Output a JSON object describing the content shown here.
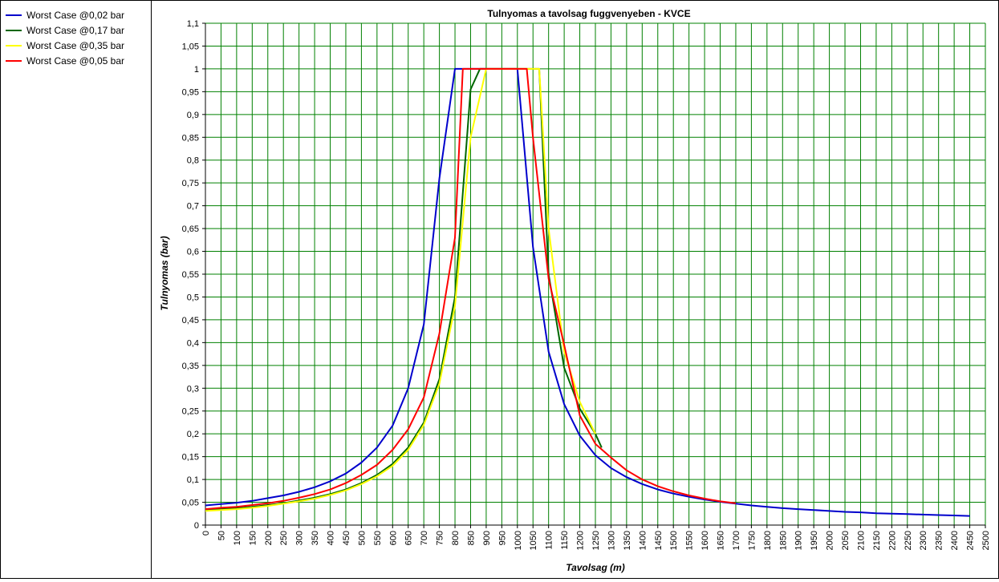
{
  "chart_data": {
    "type": "line",
    "title": "Tulnyomas a tavolsag fuggvenyeben - KVCE",
    "xlabel": "Tavolsag (m)",
    "ylabel": "Tulnyomas (bar)",
    "xlim": [
      0,
      2500
    ],
    "ylim": [
      0,
      1.1
    ],
    "x_ticks": [
      0,
      50,
      100,
      150,
      200,
      250,
      300,
      350,
      400,
      450,
      500,
      550,
      600,
      650,
      700,
      750,
      800,
      850,
      900,
      950,
      1000,
      1050,
      1100,
      1150,
      1200,
      1250,
      1300,
      1350,
      1400,
      1450,
      1500,
      1550,
      1600,
      1650,
      1700,
      1750,
      1800,
      1850,
      1900,
      1950,
      2000,
      2050,
      2100,
      2150,
      2200,
      2250,
      2300,
      2350,
      2400,
      2450,
      2500
    ],
    "x_tick_labels": [
      "0",
      "50",
      "100",
      "150",
      "200",
      "250",
      "300",
      "350",
      "400",
      "450",
      "500",
      "550",
      "600",
      "650",
      "700",
      "750",
      "800",
      "850",
      "900",
      "950",
      "1000",
      "1050",
      "1100",
      "1150",
      "1200",
      "1250",
      "1300",
      "1350",
      "1400",
      "1450",
      "1500",
      "1550",
      "1600",
      "1650",
      "1700",
      "1750",
      "1800",
      "1850",
      "1900",
      "1950",
      "2000",
      "2050",
      "2100",
      "2150",
      "2200",
      "2250",
      "2300",
      "2350",
      "2400",
      "2450",
      "2500"
    ],
    "y_ticks": [
      0,
      0.05,
      0.1,
      0.15,
      0.2,
      0.25,
      0.3,
      0.35,
      0.4,
      0.45,
      0.5,
      0.55,
      0.6,
      0.65,
      0.7,
      0.75,
      0.8,
      0.85,
      0.9,
      0.95,
      1,
      1.05,
      1.1
    ],
    "y_tick_labels": [
      "0",
      "0,05",
      "0,1",
      "0,15",
      "0,2",
      "0,25",
      "0,3",
      "0,35",
      "0,4",
      "0,45",
      "0,5",
      "0,55",
      "0,6",
      "0,65",
      "0,7",
      "0,75",
      "0,8",
      "0,85",
      "0,9",
      "0,95",
      "1",
      "1,05",
      "1,1"
    ],
    "grid": true,
    "grid_color": "#008000",
    "legend_position": "left panel",
    "series": [
      {
        "name": "Worst Case @0,02 bar",
        "color": "#0000cc",
        "points": [
          [
            0,
            0.043
          ],
          [
            50,
            0.046
          ],
          [
            100,
            0.049
          ],
          [
            150,
            0.053
          ],
          [
            200,
            0.059
          ],
          [
            250,
            0.065
          ],
          [
            300,
            0.073
          ],
          [
            350,
            0.083
          ],
          [
            400,
            0.096
          ],
          [
            450,
            0.113
          ],
          [
            500,
            0.137
          ],
          [
            550,
            0.17
          ],
          [
            600,
            0.218
          ],
          [
            650,
            0.3
          ],
          [
            700,
            0.44
          ],
          [
            750,
            0.76
          ],
          [
            800,
            1.0
          ],
          [
            1000,
            1.0
          ],
          [
            1050,
            0.61
          ],
          [
            1100,
            0.38
          ],
          [
            1150,
            0.265
          ],
          [
            1200,
            0.196
          ],
          [
            1250,
            0.153
          ],
          [
            1300,
            0.125
          ],
          [
            1350,
            0.105
          ],
          [
            1400,
            0.09
          ],
          [
            1450,
            0.078
          ],
          [
            1500,
            0.069
          ],
          [
            1550,
            0.062
          ],
          [
            1600,
            0.056
          ],
          [
            1650,
            0.051
          ],
          [
            1700,
            0.047
          ],
          [
            1750,
            0.043
          ],
          [
            1800,
            0.04
          ],
          [
            1850,
            0.037
          ],
          [
            1900,
            0.035
          ],
          [
            1950,
            0.033
          ],
          [
            2000,
            0.031
          ],
          [
            2050,
            0.029
          ],
          [
            2100,
            0.028
          ],
          [
            2150,
            0.026
          ],
          [
            2200,
            0.025
          ],
          [
            2250,
            0.024
          ],
          [
            2300,
            0.023
          ],
          [
            2350,
            0.022
          ],
          [
            2400,
            0.021
          ],
          [
            2450,
            0.02
          ]
        ]
      },
      {
        "name": "Worst Case @0,17 bar",
        "color": "#006600",
        "points": [
          [
            0,
            0.033
          ],
          [
            50,
            0.035
          ],
          [
            100,
            0.037
          ],
          [
            150,
            0.04
          ],
          [
            200,
            0.044
          ],
          [
            250,
            0.048
          ],
          [
            300,
            0.054
          ],
          [
            350,
            0.06
          ],
          [
            400,
            0.068
          ],
          [
            450,
            0.078
          ],
          [
            500,
            0.092
          ],
          [
            550,
            0.11
          ],
          [
            600,
            0.134
          ],
          [
            650,
            0.17
          ],
          [
            700,
            0.225
          ],
          [
            750,
            0.32
          ],
          [
            800,
            0.5
          ],
          [
            850,
            0.955
          ],
          [
            880,
            1.0
          ],
          [
            1070,
            1.0
          ],
          [
            1100,
            0.55
          ],
          [
            1150,
            0.345
          ],
          [
            1200,
            0.255
          ],
          [
            1250,
            0.2
          ],
          [
            1270,
            0.17
          ]
        ]
      },
      {
        "name": "Worst Case @0,35 bar",
        "color": "#ffff00",
        "points": [
          [
            0,
            0.031
          ],
          [
            50,
            0.033
          ],
          [
            100,
            0.035
          ],
          [
            150,
            0.038
          ],
          [
            200,
            0.042
          ],
          [
            250,
            0.047
          ],
          [
            300,
            0.052
          ],
          [
            350,
            0.058
          ],
          [
            400,
            0.066
          ],
          [
            450,
            0.076
          ],
          [
            500,
            0.09
          ],
          [
            550,
            0.107
          ],
          [
            600,
            0.13
          ],
          [
            650,
            0.165
          ],
          [
            700,
            0.22
          ],
          [
            750,
            0.31
          ],
          [
            800,
            0.48
          ],
          [
            850,
            0.85
          ],
          [
            900,
            1.0
          ],
          [
            1070,
            1.0
          ],
          [
            1100,
            0.65
          ],
          [
            1150,
            0.38
          ],
          [
            1200,
            0.27
          ],
          [
            1250,
            0.2
          ]
        ]
      },
      {
        "name": "Worst Case @0,05 bar",
        "color": "#ff0000",
        "points": [
          [
            0,
            0.035
          ],
          [
            50,
            0.038
          ],
          [
            100,
            0.04
          ],
          [
            150,
            0.044
          ],
          [
            200,
            0.048
          ],
          [
            250,
            0.053
          ],
          [
            300,
            0.06
          ],
          [
            350,
            0.068
          ],
          [
            400,
            0.078
          ],
          [
            450,
            0.092
          ],
          [
            500,
            0.11
          ],
          [
            550,
            0.132
          ],
          [
            600,
            0.165
          ],
          [
            650,
            0.21
          ],
          [
            700,
            0.28
          ],
          [
            750,
            0.42
          ],
          [
            800,
            0.63
          ],
          [
            825,
            1.0
          ],
          [
            1030,
            1.0
          ],
          [
            1050,
            0.85
          ],
          [
            1100,
            0.54
          ],
          [
            1150,
            0.395
          ],
          [
            1200,
            0.24
          ],
          [
            1250,
            0.178
          ],
          [
            1300,
            0.148
          ],
          [
            1350,
            0.12
          ],
          [
            1400,
            0.1
          ],
          [
            1450,
            0.085
          ],
          [
            1500,
            0.074
          ],
          [
            1550,
            0.065
          ],
          [
            1600,
            0.058
          ],
          [
            1650,
            0.052
          ],
          [
            1700,
            0.048
          ]
        ]
      }
    ]
  }
}
